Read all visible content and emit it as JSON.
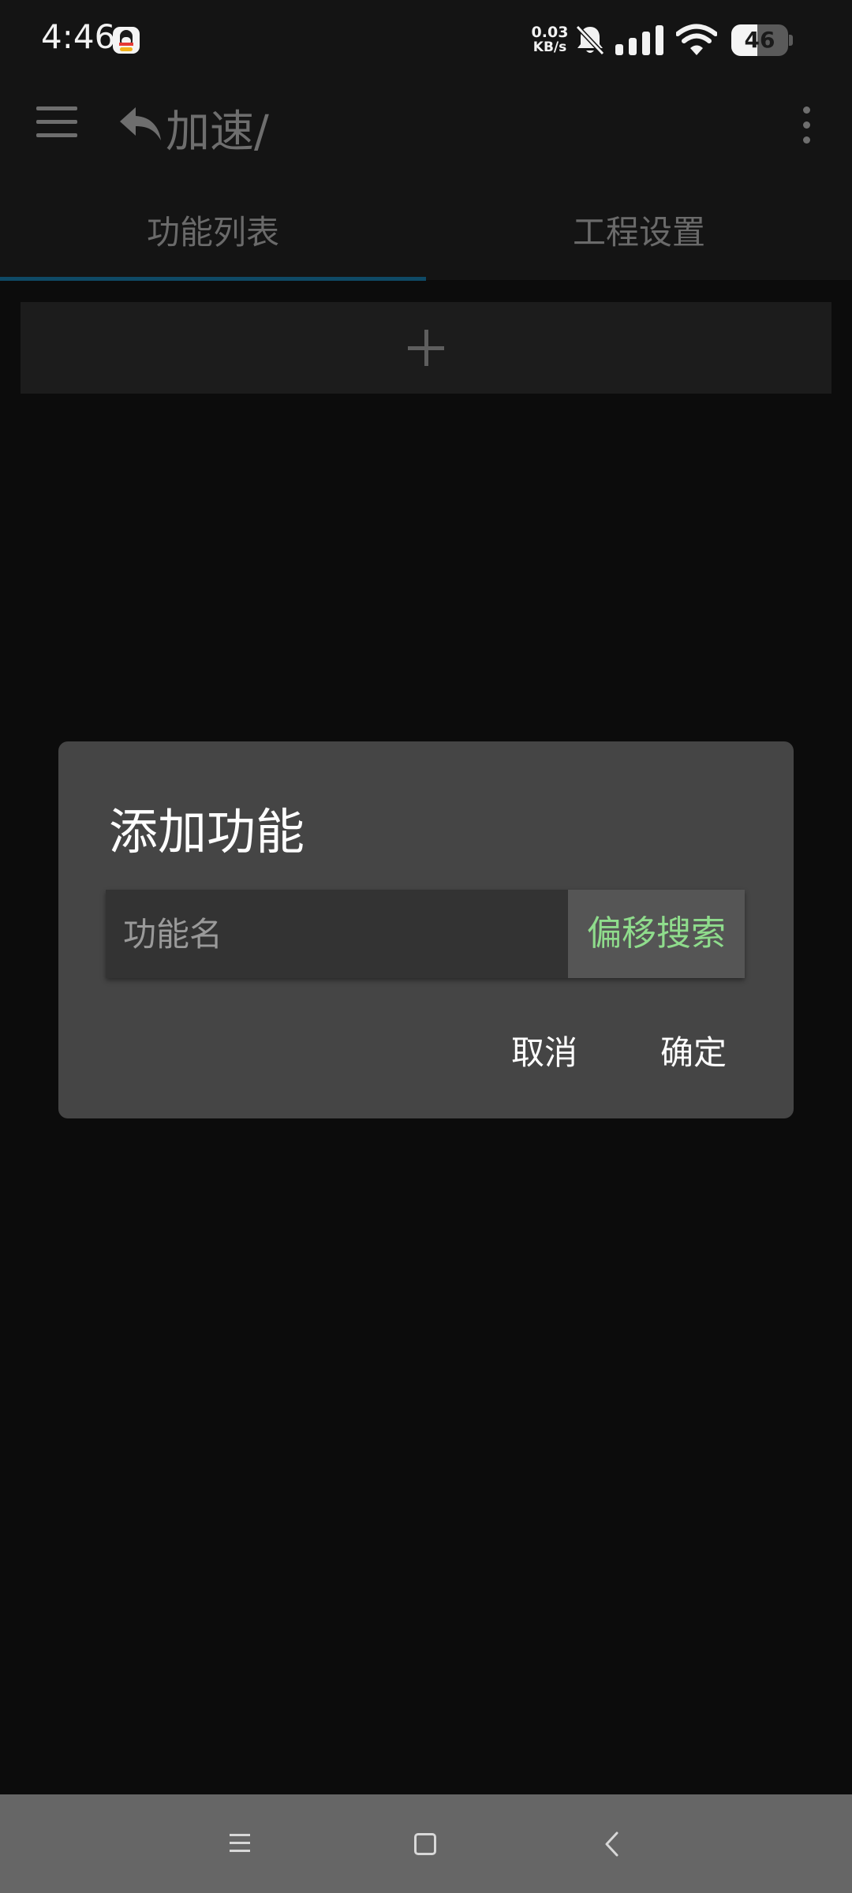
{
  "status_bar": {
    "time": "4:46",
    "net_speed_value": "0.03",
    "net_speed_unit": "KB/s",
    "battery_level": "46",
    "battery_fraction": 0.46
  },
  "app_bar": {
    "title": "加速/"
  },
  "tabs": [
    {
      "label": "功能列表",
      "selected": true
    },
    {
      "label": "工程设置",
      "selected": false
    }
  ],
  "dialog": {
    "title": "添加功能",
    "input_placeholder": "功能名",
    "input_value": "",
    "offset_search_label": "偏移搜索",
    "cancel_label": "取消",
    "confirm_label": "确定"
  },
  "colors": {
    "background": "#0c0c0c",
    "bar": "#141414",
    "dialog": "#454545",
    "accent_green": "#8fdc8c",
    "tab_indicator": "#0f4a66"
  }
}
